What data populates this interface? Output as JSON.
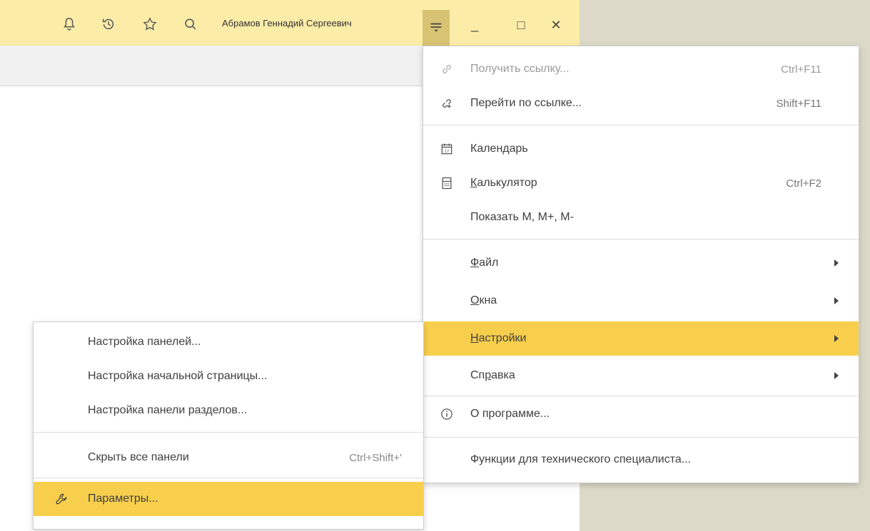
{
  "topbar": {
    "username": "Абрамов Геннадий Сергеевич",
    "icons": [
      "bell-icon",
      "history-icon",
      "star-icon",
      "search-icon",
      "menu-icon",
      "minimize-icon",
      "maximize-icon",
      "close-icon"
    ],
    "minimize_glyph": "_",
    "maximize_glyph": "□",
    "close_glyph": "✕"
  },
  "colors": {
    "toolbar": "#fbeca8",
    "menu_button": "#d8c373",
    "highlight": "#f7cf4d",
    "desktop": "#dcd9c8"
  },
  "main_menu": {
    "items": [
      {
        "label": "Получить ссылку...",
        "shortcut": "Ctrl+F11",
        "icon": "link-icon",
        "disabled": true
      },
      {
        "label": "Перейти по ссылке...",
        "shortcut": "Shift+F11",
        "icon": "goto-link-icon"
      },
      {
        "label": "Календарь",
        "shortcut": "",
        "icon": "calendar-icon",
        "calendar_day": "17"
      },
      {
        "label_first": "К",
        "label_rest": "алькулятор",
        "shortcut": "Ctrl+F2",
        "icon": "calculator-icon"
      },
      {
        "label": "Показать M, M+, M-",
        "shortcut": ""
      },
      {
        "label_first": "Ф",
        "label_rest": "айл",
        "submenu": true
      },
      {
        "label_first": "О",
        "label_rest": "кна",
        "submenu": true
      },
      {
        "label_first": "Н",
        "label_rest": "астройки",
        "submenu": true,
        "active": true
      },
      {
        "label_pre": "Сп",
        "label_u": "р",
        "label_rest": "авка",
        "submenu": true
      },
      {
        "label": "О программе...",
        "icon": "info-icon"
      },
      {
        "label": "Функции для технического специалиста..."
      }
    ]
  },
  "sub_menu": {
    "items": [
      {
        "label": "Настройка панелей..."
      },
      {
        "label": "Настройка начальной страницы..."
      },
      {
        "label": "Настройка панели разделов..."
      },
      {
        "label": "Скрыть все панели",
        "shortcut": "Ctrl+Shift+'"
      },
      {
        "label": "Параметры...",
        "icon": "wrench-icon",
        "active": true
      }
    ]
  }
}
